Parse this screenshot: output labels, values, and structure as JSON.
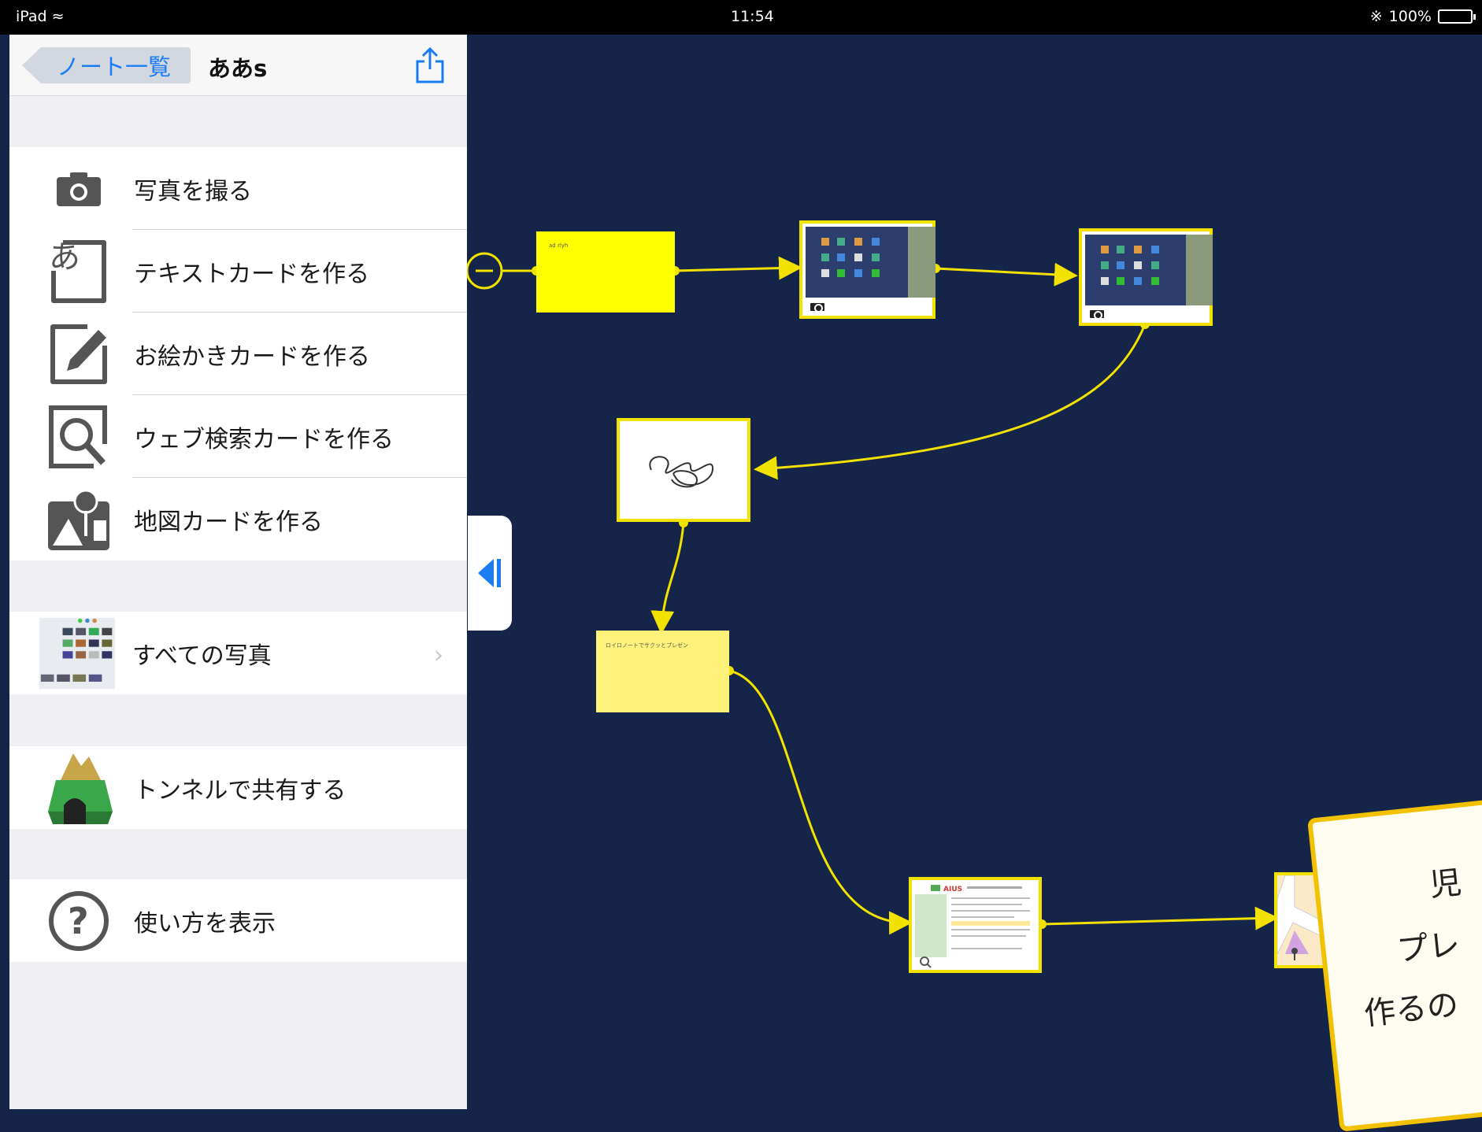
{
  "status_bar": {
    "device": "iPad",
    "time": "11:54",
    "battery": "100%"
  },
  "nav": {
    "back_label": "ノート一覧",
    "title": "ああs"
  },
  "menu": {
    "take_photo": "写真を撮る",
    "text_card": "テキストカードを作る",
    "drawing_card": "お絵かきカードを作る",
    "web_card": "ウェブ検索カードを作る",
    "map_card": "地図カードを作る",
    "all_photos": "すべての写真",
    "tunnel_share": "トンネルで共有する",
    "show_help": "使い方を表示",
    "text_icon_char": "あ"
  },
  "canvas": {
    "card1_text": "ad rlyh",
    "card4_text": "ロイロノートでサクッとプレゼン",
    "web_card_brand": "AIUS"
  },
  "callout": {
    "line1": "児",
    "line2": "プレ",
    "line3": "作るの"
  },
  "colors": {
    "accent": "#1a7cf5",
    "canvas_bg": "#152449",
    "card_yellow": "#f2e200"
  }
}
